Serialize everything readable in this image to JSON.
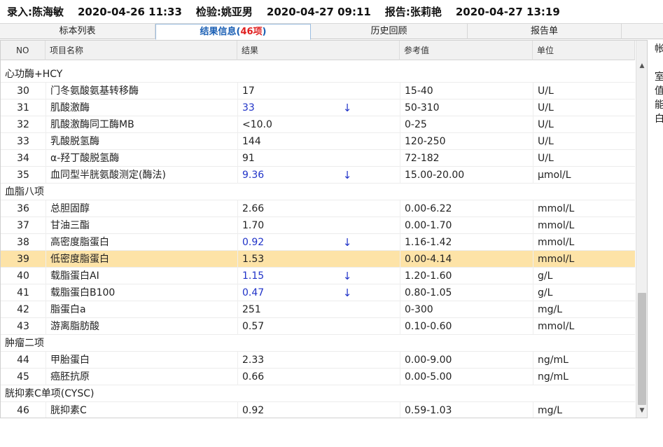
{
  "header": {
    "entry": "录入:陈海敏",
    "entry_time": "2020-04-26 11:33",
    "check": "检验:姚亚男",
    "check_time": "2020-04-27 09:11",
    "report": "报告:张莉艳",
    "report_time": "2020-04-27 13:19"
  },
  "tabs": [
    {
      "label": "标本列表"
    },
    {
      "label": "结果信息(",
      "count": "46项",
      "suffix": ")"
    },
    {
      "label": "历史回顾"
    },
    {
      "label": "报告单"
    }
  ],
  "table": {
    "columns": [
      "NO",
      "项目名称",
      "结果",
      "参考值",
      "单位"
    ],
    "groups": {
      "g1": "心功酶+HCY",
      "g2": "血脂八项",
      "g3": "肿瘤二项",
      "g4": "胱抑素C单项(CYSC)"
    },
    "rows": [
      {
        "no": "30",
        "name": "门冬氨酸氨基转移酶",
        "result": "17",
        "flag": "",
        "ref": "15-40",
        "unit": "U/L"
      },
      {
        "no": "31",
        "name": "肌酸激酶",
        "result": "33",
        "flag": "↓",
        "ref": "50-310",
        "unit": "U/L"
      },
      {
        "no": "32",
        "name": "肌酸激酶同工酶MB",
        "result": "<10.0",
        "flag": "",
        "ref": "0-25",
        "unit": "U/L"
      },
      {
        "no": "33",
        "name": "乳酸脱氢酶",
        "result": "144",
        "flag": "",
        "ref": "120-250",
        "unit": "U/L"
      },
      {
        "no": "34",
        "name": "α-羟丁酸脱氢酶",
        "result": "91",
        "flag": "",
        "ref": "72-182",
        "unit": "U/L"
      },
      {
        "no": "35",
        "name": "血同型半胱氨酸测定(酶法)",
        "result": "9.36",
        "flag": "↓",
        "ref": "15.00-20.00",
        "unit": "μmol/L"
      },
      {
        "no": "36",
        "name": "总胆固醇",
        "result": "2.66",
        "flag": "",
        "ref": "0.00-6.22",
        "unit": "mmol/L"
      },
      {
        "no": "37",
        "name": "甘油三酯",
        "result": "1.70",
        "flag": "",
        "ref": "0.00-1.70",
        "unit": "mmol/L"
      },
      {
        "no": "38",
        "name": "高密度脂蛋白",
        "result": "0.92",
        "flag": "↓",
        "ref": "1.16-1.42",
        "unit": "mmol/L"
      },
      {
        "no": "39",
        "name": "低密度脂蛋白",
        "result": "1.53",
        "flag": "",
        "ref": "0.00-4.14",
        "unit": "mmol/L"
      },
      {
        "no": "40",
        "name": "载脂蛋白AI",
        "result": "1.15",
        "flag": "↓",
        "ref": "1.20-1.60",
        "unit": "g/L"
      },
      {
        "no": "41",
        "name": "载脂蛋白B100",
        "result": "0.47",
        "flag": "↓",
        "ref": "0.80-1.05",
        "unit": "g/L"
      },
      {
        "no": "42",
        "name": "脂蛋白a",
        "result": "251",
        "flag": "",
        "ref": "0-300",
        "unit": "mg/L"
      },
      {
        "no": "43",
        "name": "游离脂肪酸",
        "result": "0.57",
        "flag": "",
        "ref": "0.10-0.60",
        "unit": "mmol/L"
      },
      {
        "no": "44",
        "name": "甲胎蛋白",
        "result": "2.33",
        "flag": "",
        "ref": "0.00-9.00",
        "unit": "ng/mL"
      },
      {
        "no": "45",
        "name": "癌胚抗原",
        "result": "0.66",
        "flag": "",
        "ref": "0.00-5.00",
        "unit": "ng/mL"
      },
      {
        "no": "46",
        "name": "胱抑素C",
        "result": "0.92",
        "flag": "",
        "ref": "0.59-1.03",
        "unit": "mg/L"
      }
    ]
  },
  "side_panel": {
    "chars": [
      "帐",
      "室",
      "值",
      "能",
      "白"
    ]
  },
  "colors": {
    "highlight_row": "#fde3a7",
    "low_value": "#2033c8",
    "active_tab_text": "#1a5fb4",
    "tab_count": "#e02020"
  }
}
